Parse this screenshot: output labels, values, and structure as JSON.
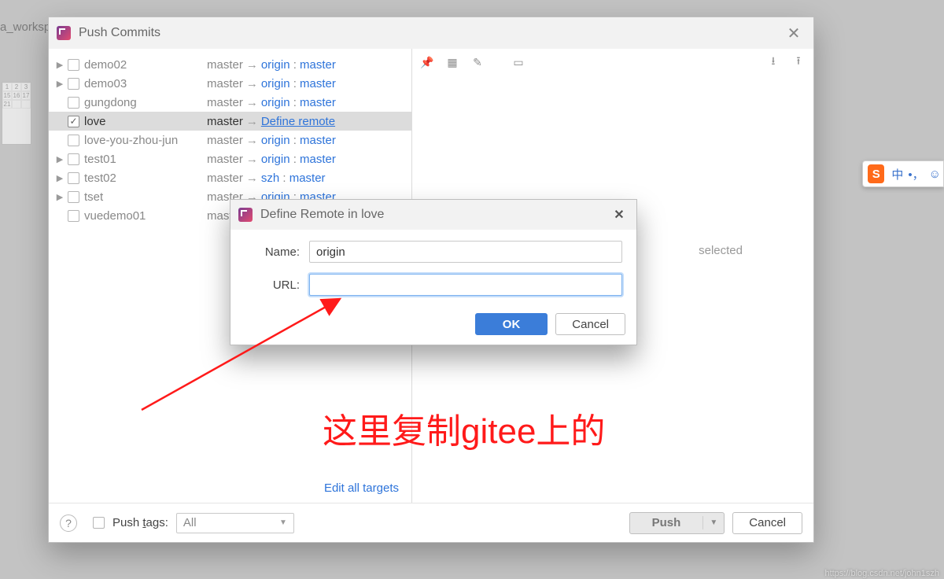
{
  "bg": {
    "label": "a_worksp"
  },
  "window": {
    "title": "Push Commits"
  },
  "repos": [
    {
      "name": "demo02",
      "expand": true,
      "checked": false,
      "local": "master",
      "remote": "origin",
      "remoteBranch": "master",
      "define": false,
      "selected": false
    },
    {
      "name": "demo03",
      "expand": true,
      "checked": false,
      "local": "master",
      "remote": "origin",
      "remoteBranch": "master",
      "define": false,
      "selected": false
    },
    {
      "name": "gungdong",
      "expand": false,
      "checked": false,
      "local": "master",
      "remote": "origin",
      "remoteBranch": "master",
      "define": false,
      "selected": false
    },
    {
      "name": "love",
      "expand": false,
      "checked": true,
      "local": "master",
      "remote": "",
      "remoteBranch": "",
      "define": true,
      "defineLabel": "Define remote",
      "selected": true
    },
    {
      "name": "love-you-zhou-jun",
      "expand": false,
      "checked": false,
      "local": "master",
      "remote": "origin",
      "remoteBranch": "master",
      "define": false,
      "selected": false
    },
    {
      "name": "test01",
      "expand": true,
      "checked": false,
      "local": "master",
      "remote": "origin",
      "remoteBranch": "master",
      "define": false,
      "selected": false
    },
    {
      "name": "test02",
      "expand": true,
      "checked": false,
      "local": "master",
      "remote": "szh",
      "remoteBranch": "master",
      "define": false,
      "selected": false
    },
    {
      "name": "tset",
      "expand": true,
      "checked": false,
      "local": "master",
      "remote": "origin",
      "remoteBranch": "master",
      "define": false,
      "selected": false
    },
    {
      "name": "vuedemo01",
      "expand": false,
      "checked": false,
      "local": "maste",
      "remote": "",
      "remoteBranch": "",
      "define": false,
      "selected": false,
      "truncated": true
    }
  ],
  "leftFooterLink": "Edit all targets",
  "rightMessage": "selected",
  "bottom": {
    "pushTagsLabel": "Push tags:",
    "pushTagsAccel": "t",
    "tagFilter": "All",
    "pushLabel": "Push",
    "cancelLabel": "Cancel"
  },
  "sub": {
    "title": "Define Remote in love",
    "nameLabel": "Name:",
    "nameValue": "origin",
    "urlLabel": "URL:",
    "urlValue": "",
    "ok": "OK",
    "cancel": "Cancel"
  },
  "annotation": "这里复制gitee上的",
  "ime": {
    "logo": "S",
    "lang": "中"
  },
  "watermark": "https://blog.csdn.net/john1szh"
}
